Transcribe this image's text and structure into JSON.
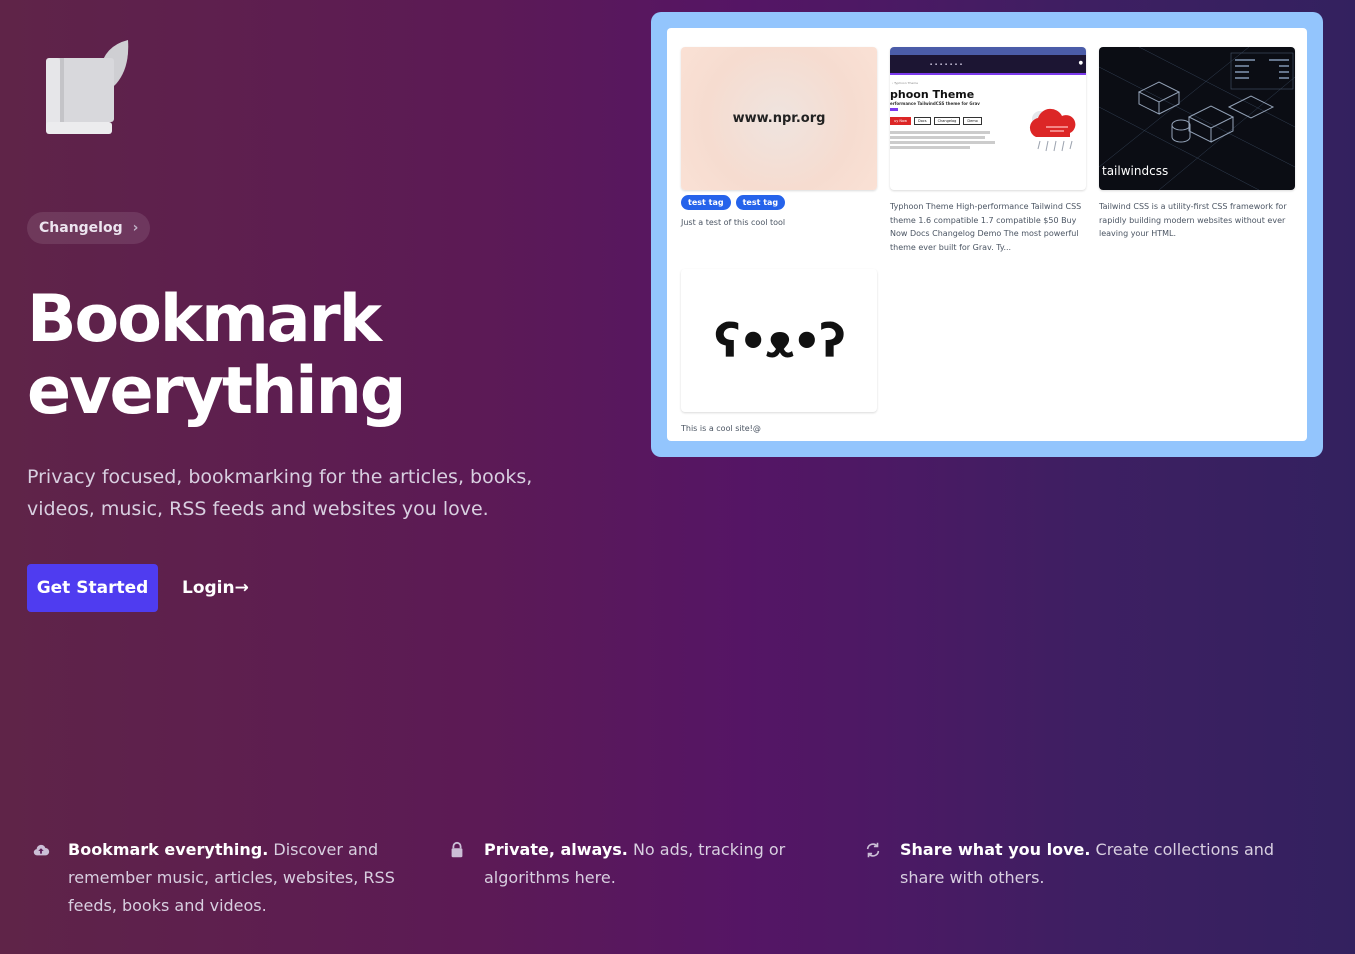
{
  "hero": {
    "changelog_label": "Changelog",
    "title_line1": "Bookmark",
    "title_line2": "everything",
    "subtitle": "Privacy focused, bookmarking for the articles, books, videos, music, RSS feeds and websites you love.",
    "get_started_label": "Get Started",
    "login_label": "Login→"
  },
  "features": [
    {
      "icon": "cloud-upload-icon",
      "title": "Bookmark everything.",
      "line1": " Discover and",
      "line2": "remember music, articles, websites, RSS",
      "line3": "feeds, books and videos."
    },
    {
      "icon": "lock-icon",
      "title": "Private, always.",
      "line1": " No ads, tracking or",
      "line2": "algorithms here."
    },
    {
      "icon": "refresh-icon",
      "title": "Share what you love.",
      "line1": " Create collections and",
      "line2": "share with others."
    }
  ],
  "preview": {
    "cards": [
      {
        "thumb_text": "www.npr.org",
        "tags": [
          "test tag",
          "test tag"
        ],
        "description": "Just a test of this cool tool"
      },
      {
        "thumb_title": "phoon Theme",
        "thumb_subtitle": "erformance TailwindCSS theme for Grav",
        "thumb_crumb": "‹ Typhoon Theme",
        "thumb_buttons": [
          "uy Now",
          "Docs",
          "Changelog",
          "Demo"
        ],
        "description": "Typhoon Theme High-performance Tailwind CSS theme 1.6 compatible 1.7 compatible $50 Buy Now Docs Changelog Demo The most powerful theme ever built for Grav. Ty..."
      },
      {
        "thumb_text": "tailwindcss",
        "description": "Tailwind CSS is a utility-first CSS framework for rapidly building modern websites without ever leaving your HTML."
      },
      {
        "thumb_text": "ʕ•ᴥ•ʔ",
        "description": "This is a cool site!@"
      }
    ]
  },
  "colors": {
    "primary_button": "#4f3cf0",
    "frame": "#93c5fd",
    "tag": "#2563eb"
  }
}
